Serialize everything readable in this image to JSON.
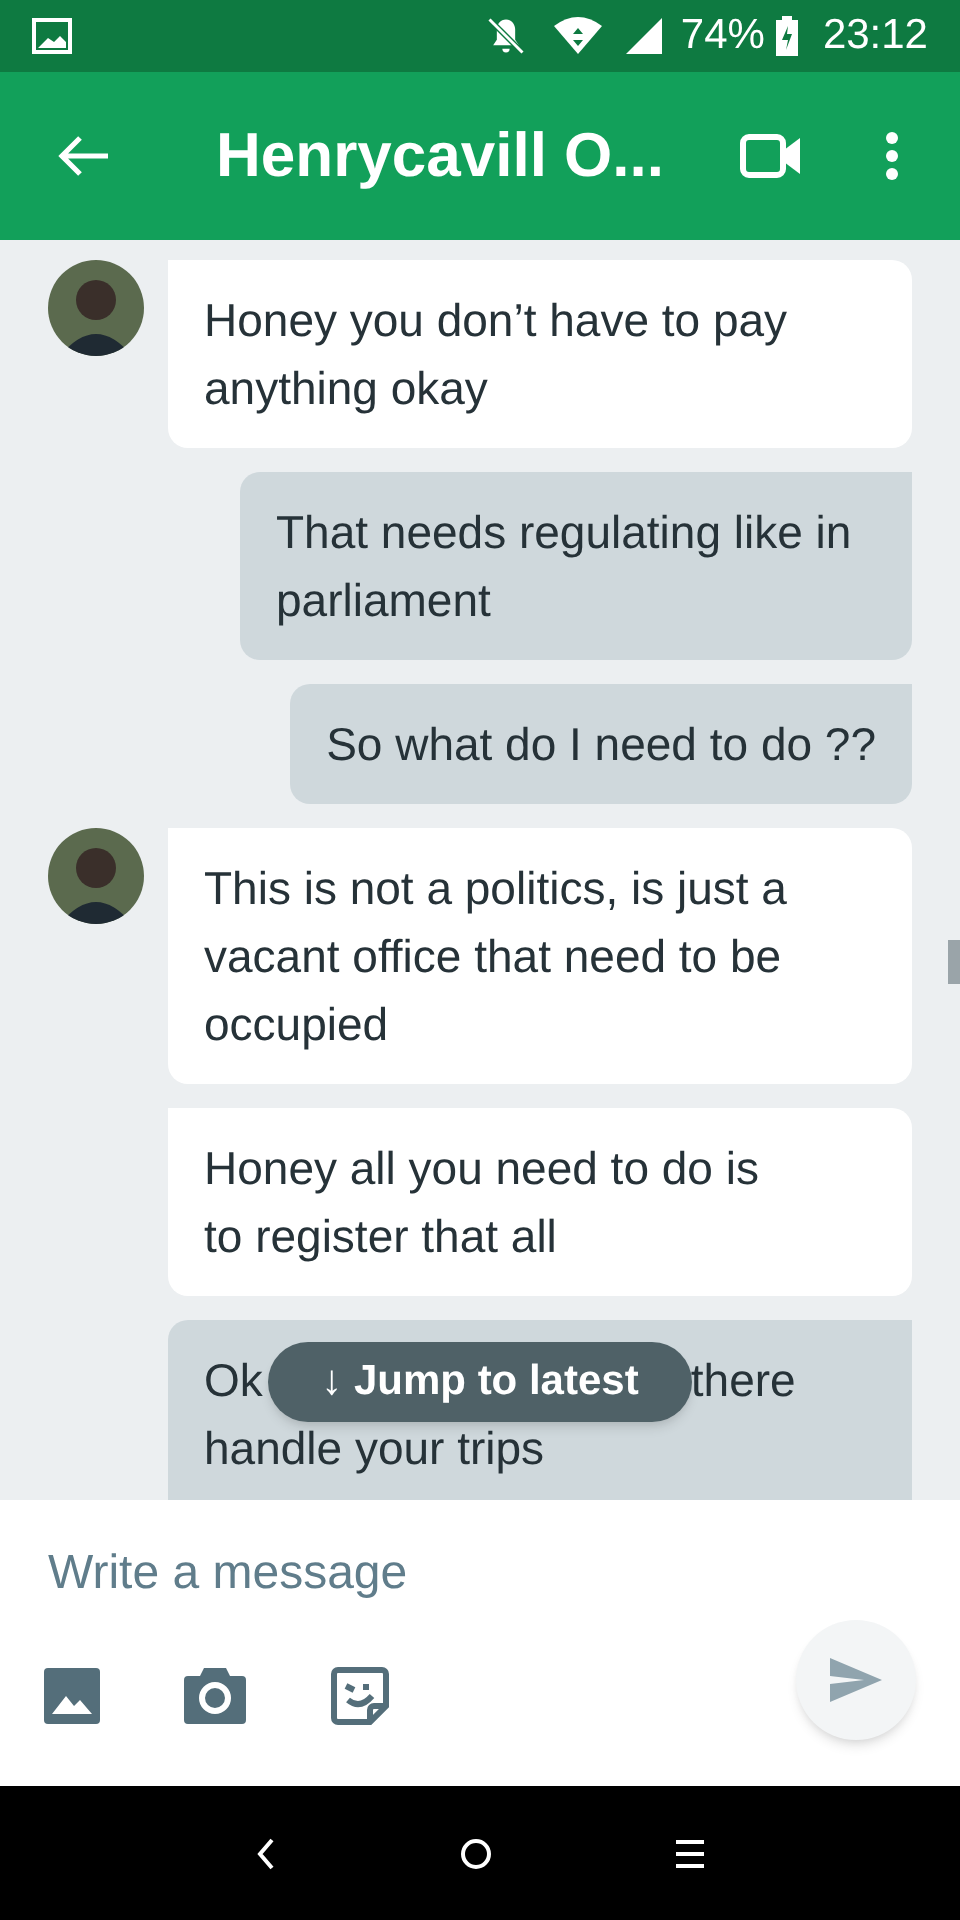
{
  "status_bar": {
    "battery": "74%",
    "time": "23:12"
  },
  "app_bar": {
    "title": "Henrycavill O..."
  },
  "messages": [
    {
      "kind": "incoming",
      "avatar": true,
      "text": "Honey you don’t have to pay anything okay"
    },
    {
      "kind": "outgoing",
      "text": "That needs regulating like in parliament"
    },
    {
      "kind": "outgoing",
      "text": "So what do I need to do ??"
    },
    {
      "kind": "incoming",
      "avatar": true,
      "text": "This is not a politics, is just a vacant office that need to be occupied"
    },
    {
      "kind": "incoming",
      "avatar": false,
      "text": "Honey all you need to do is to register that all"
    },
    {
      "kind": "covered",
      "line_1_start": "Ok",
      "line_1_end": "there",
      "line_2": "handle your trips"
    }
  ],
  "jump_button": {
    "label": "↓ Jump to latest"
  },
  "composer": {
    "placeholder": "Write a message"
  }
}
